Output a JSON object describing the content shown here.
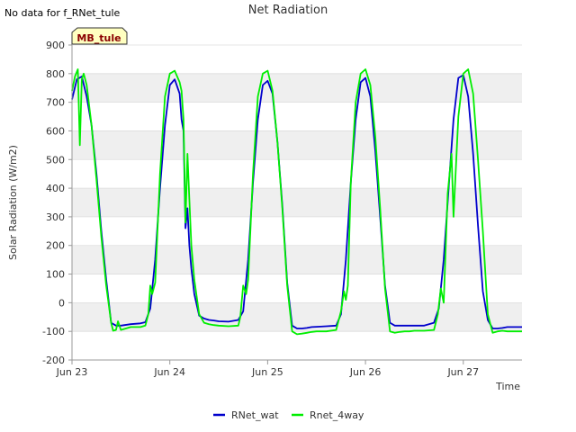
{
  "chart_data": {
    "type": "line",
    "title": "Net Radiation",
    "note": "No data for f_RNet_tule",
    "site_badge": "MB_tule",
    "xlabel": "Time",
    "ylabel": "Solar Radiation (W/m2)",
    "ylim": [
      -200,
      900
    ],
    "yticks": [
      -200,
      -100,
      0,
      100,
      200,
      300,
      400,
      500,
      600,
      700,
      800,
      900
    ],
    "xlim": [
      0,
      4.6
    ],
    "xticks": [
      {
        "value": 0,
        "label": "Jun 23"
      },
      {
        "value": 1,
        "label": "Jun 24"
      },
      {
        "value": 2,
        "label": "Jun 25"
      },
      {
        "value": 3,
        "label": "Jun 26"
      },
      {
        "value": 4,
        "label": "Jun 27"
      }
    ],
    "grid_bands": true,
    "legend_position": "bottom-center",
    "series": [
      {
        "name": "RNet_wat",
        "color": "#0000cc",
        "x": [
          0.0,
          0.05,
          0.1,
          0.15,
          0.2,
          0.25,
          0.3,
          0.35,
          0.4,
          0.45,
          0.5,
          0.6,
          0.7,
          0.75,
          0.8,
          0.85,
          0.9,
          0.95,
          1.0,
          1.05,
          1.1,
          1.12,
          1.14,
          1.16,
          1.18,
          1.2,
          1.22,
          1.25,
          1.3,
          1.35,
          1.4,
          1.45,
          1.5,
          1.6,
          1.7,
          1.75,
          1.8,
          1.85,
          1.9,
          1.95,
          2.0,
          2.05,
          2.1,
          2.15,
          2.2,
          2.25,
          2.3,
          2.35,
          2.4,
          2.45,
          2.5,
          2.6,
          2.7,
          2.75,
          2.8,
          2.85,
          2.9,
          2.95,
          3.0,
          3.05,
          3.1,
          3.15,
          3.2,
          3.25,
          3.3,
          3.35,
          3.4,
          3.45,
          3.5,
          3.6,
          3.7,
          3.75,
          3.8,
          3.85,
          3.9,
          3.95,
          4.0,
          4.05,
          4.1,
          4.15,
          4.2,
          4.25,
          4.3,
          4.35,
          4.4,
          4.45,
          4.5,
          4.55,
          4.6
        ],
        "y": [
          710,
          780,
          790,
          720,
          620,
          450,
          250,
          80,
          -70,
          -80,
          -80,
          -75,
          -72,
          -68,
          -20,
          150,
          400,
          620,
          760,
          780,
          730,
          640,
          600,
          260,
          330,
          200,
          120,
          30,
          -45,
          -55,
          -60,
          -62,
          -65,
          -66,
          -60,
          -30,
          150,
          420,
          640,
          760,
          775,
          730,
          560,
          340,
          70,
          -80,
          -90,
          -90,
          -88,
          -85,
          -84,
          -82,
          -80,
          -40,
          150,
          420,
          640,
          770,
          785,
          720,
          530,
          300,
          60,
          -70,
          -80,
          -80,
          -80,
          -80,
          -80,
          -80,
          -70,
          -20,
          150,
          400,
          640,
          785,
          795,
          720,
          520,
          270,
          40,
          -60,
          -90,
          -90,
          -88,
          -85,
          -85,
          -85,
          -85
        ]
      },
      {
        "name": "Rnet_4way",
        "color": "#00ee00",
        "x": [
          0.0,
          0.03,
          0.06,
          0.08,
          0.1,
          0.12,
          0.15,
          0.2,
          0.25,
          0.3,
          0.35,
          0.4,
          0.42,
          0.45,
          0.47,
          0.5,
          0.55,
          0.6,
          0.7,
          0.75,
          0.78,
          0.8,
          0.82,
          0.85,
          0.9,
          0.95,
          1.0,
          1.05,
          1.1,
          1.12,
          1.14,
          1.16,
          1.18,
          1.2,
          1.22,
          1.25,
          1.3,
          1.35,
          1.4,
          1.45,
          1.5,
          1.6,
          1.7,
          1.72,
          1.75,
          1.78,
          1.8,
          1.85,
          1.9,
          1.95,
          2.0,
          2.05,
          2.1,
          2.15,
          2.2,
          2.25,
          2.3,
          2.35,
          2.4,
          2.45,
          2.5,
          2.6,
          2.7,
          2.75,
          2.78,
          2.8,
          2.82,
          2.85,
          2.9,
          2.95,
          3.0,
          3.05,
          3.1,
          3.15,
          3.2,
          3.25,
          3.3,
          3.35,
          3.4,
          3.45,
          3.5,
          3.6,
          3.7,
          3.74,
          3.77,
          3.8,
          3.84,
          3.88,
          3.9,
          3.95,
          4.0,
          4.05,
          4.1,
          4.15,
          4.2,
          4.25,
          4.3,
          4.35,
          4.4,
          4.45,
          4.5,
          4.55,
          4.6
        ],
        "y": [
          740,
          790,
          815,
          550,
          780,
          800,
          760,
          620,
          430,
          230,
          60,
          -70,
          -98,
          -95,
          -65,
          -95,
          -90,
          -85,
          -85,
          -80,
          -40,
          60,
          30,
          70,
          450,
          720,
          800,
          810,
          770,
          740,
          640,
          280,
          520,
          360,
          200,
          80,
          -40,
          -70,
          -75,
          -78,
          -80,
          -82,
          -80,
          -50,
          60,
          30,
          80,
          450,
          720,
          800,
          810,
          740,
          560,
          330,
          60,
          -100,
          -110,
          -108,
          -105,
          -102,
          -100,
          -100,
          -95,
          -30,
          40,
          10,
          60,
          420,
          700,
          800,
          815,
          760,
          580,
          330,
          50,
          -100,
          -105,
          -102,
          -100,
          -100,
          -98,
          -98,
          -95,
          -40,
          50,
          0,
          380,
          520,
          300,
          650,
          800,
          815,
          730,
          500,
          250,
          -40,
          -105,
          -100,
          -98,
          -100,
          -100,
          -100,
          -100
        ]
      }
    ]
  }
}
